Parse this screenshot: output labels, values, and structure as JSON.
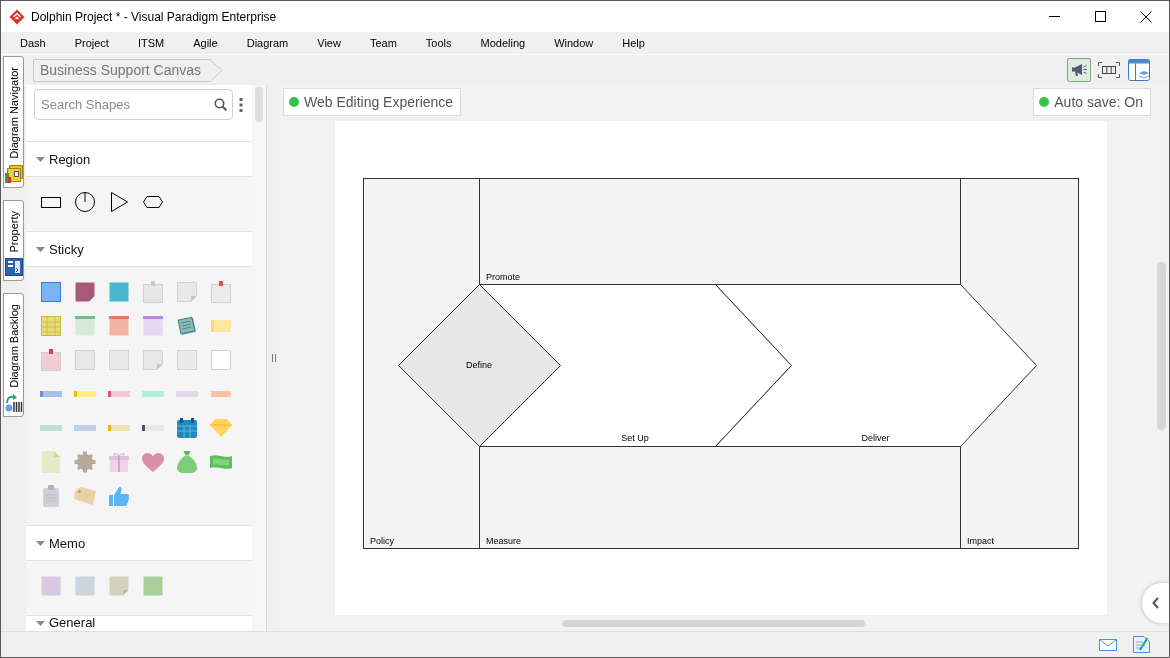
{
  "window": {
    "title": "Dolphin Project * - Visual Paradigm Enterprise"
  },
  "menu": [
    "Dash",
    "Project",
    "ITSM",
    "Agile",
    "Diagram",
    "View",
    "Team",
    "Tools",
    "Modeling",
    "Window",
    "Help"
  ],
  "side_tabs": [
    {
      "label": "Diagram Navigator",
      "kind": "navigator"
    },
    {
      "label": "Property",
      "kind": "property"
    },
    {
      "label": "Diagram Backlog",
      "kind": "backlog"
    }
  ],
  "breadcrumb": [
    "Business Support Canvas"
  ],
  "toolbar": [
    {
      "kind": "announce",
      "selected": true
    },
    {
      "kind": "fit",
      "selected": false
    },
    {
      "kind": "layout",
      "selected": false
    }
  ],
  "shape_panel": {
    "search": {
      "placeholder": "Search Shapes"
    },
    "sections": [
      {
        "title": "Region",
        "expanded": true
      },
      {
        "title": "Sticky",
        "expanded": true
      },
      {
        "title": "Memo",
        "expanded": true
      },
      {
        "title": "General",
        "expanded": true
      }
    ]
  },
  "canvas": {
    "web_editing": "Web Editing Experience",
    "autosave": "Auto save: On",
    "diagram": {
      "shapes": [
        {
          "kind": "region",
          "label": "Policy"
        },
        {
          "kind": "region",
          "label": "Promote"
        },
        {
          "kind": "region",
          "label": "Measure"
        },
        {
          "kind": "region",
          "label": "Impact"
        },
        {
          "kind": "chevron",
          "label": "Set Up"
        },
        {
          "kind": "chevron",
          "label": "Deliver"
        },
        {
          "kind": "diamond",
          "label": "Define"
        }
      ]
    }
  }
}
